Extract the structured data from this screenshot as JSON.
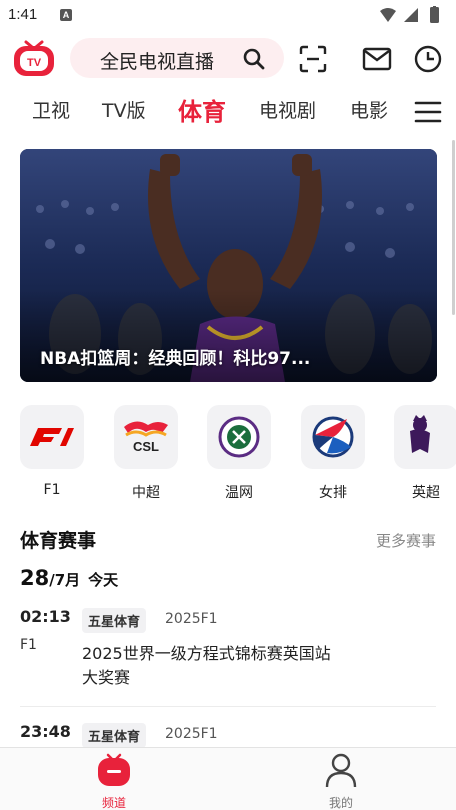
{
  "status": {
    "time": "1:41",
    "notif_icon": "A"
  },
  "search": {
    "placeholder": "全民电视直播"
  },
  "tabs": [
    {
      "label": "卫视"
    },
    {
      "label": "TV版"
    },
    {
      "label": "体育"
    },
    {
      "label": "电视剧"
    },
    {
      "label": "电影"
    }
  ],
  "banner": {
    "caption": "NBA扣篮周：经典回顾！科比97..."
  },
  "categories": [
    {
      "label": "F1",
      "icon": "f1-logo"
    },
    {
      "label": "中超",
      "icon": "csl-logo"
    },
    {
      "label": "温网",
      "icon": "wimbledon-logo"
    },
    {
      "label": "女排",
      "icon": "volleyball-logo"
    },
    {
      "label": "英超",
      "icon": "premier-league-logo"
    }
  ],
  "events": {
    "title": "体育赛事",
    "more": "更多赛事",
    "date_day": "28",
    "date_month": "/7月",
    "date_label": "今天",
    "items": [
      {
        "time": "02:13",
        "sport": "F1",
        "channel": "五星体育",
        "tag": "2025F1",
        "title": "2025世界一级方程式锦标赛英国站大奖赛"
      },
      {
        "time": "23:48",
        "channel": "五星体育",
        "tag": "2025F1"
      }
    ]
  },
  "bottom_nav": [
    {
      "label": "频道",
      "icon": "channel-icon"
    },
    {
      "label": "我的",
      "icon": "profile-icon"
    }
  ],
  "colors": {
    "accent": "#e8223b",
    "search_bg": "#fdeef0"
  }
}
